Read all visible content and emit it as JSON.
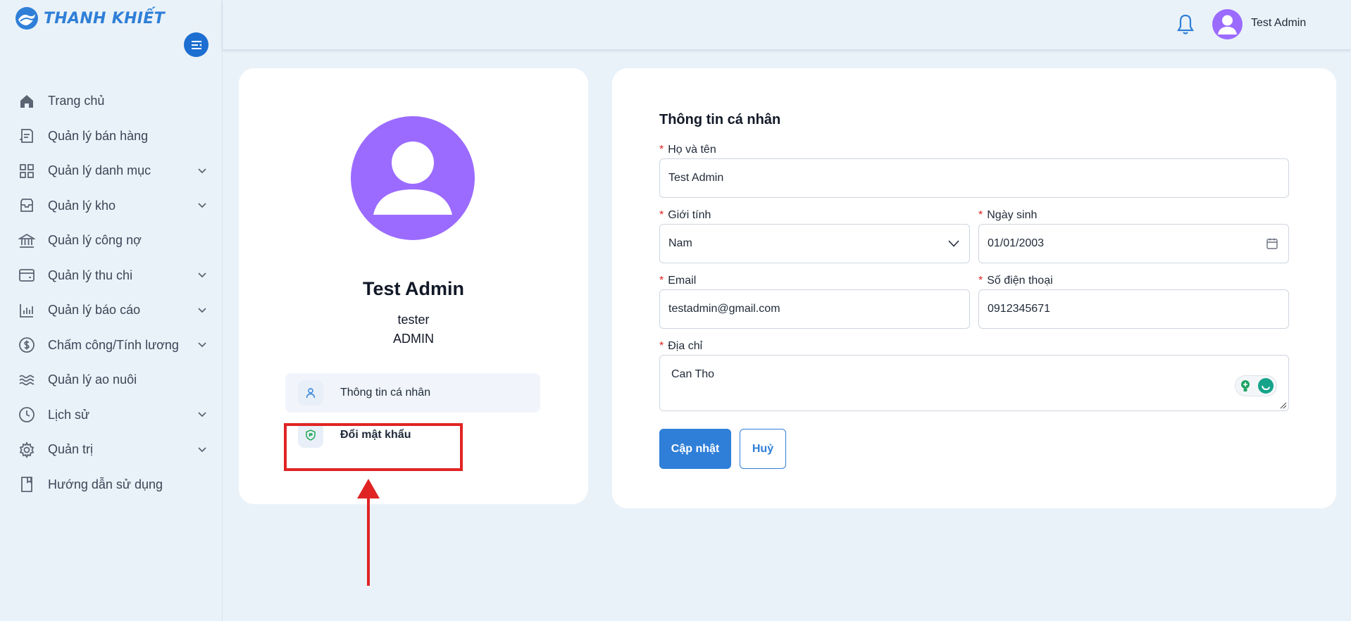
{
  "brand": {
    "name": "THANH KHIẾT",
    "accent": "#2f7fd8"
  },
  "sidebar": {
    "items": [
      {
        "label": "Trang chủ",
        "icon": "home-icon",
        "expandable": false
      },
      {
        "label": "Quản lý bán hàng",
        "icon": "sales-icon",
        "expandable": false
      },
      {
        "label": "Quản lý danh mục",
        "icon": "grid-icon",
        "expandable": true
      },
      {
        "label": "Quản lý kho",
        "icon": "inbox-icon",
        "expandable": true
      },
      {
        "label": "Quản lý công nợ",
        "icon": "bank-icon",
        "expandable": false
      },
      {
        "label": "Quản lý thu chi",
        "icon": "wallet-icon",
        "expandable": true
      },
      {
        "label": "Quản lý báo cáo",
        "icon": "bar-chart-icon",
        "expandable": true
      },
      {
        "label": "Chấm công/Tính lương",
        "icon": "dollar-icon",
        "expandable": true
      },
      {
        "label": "Quản lý ao nuôi",
        "icon": "waves-icon",
        "expandable": false
      },
      {
        "label": "Lịch sử",
        "icon": "clock-icon",
        "expandable": true
      },
      {
        "label": "Quản trị",
        "icon": "gear-icon",
        "expandable": true
      },
      {
        "label": "Hướng dẫn sử dụng",
        "icon": "book-icon",
        "expandable": false
      }
    ]
  },
  "header": {
    "user_name": "Test Admin"
  },
  "profile": {
    "name": "Test Admin",
    "username": "tester",
    "role": "ADMIN",
    "menu": {
      "info_label": "Thông tin cá nhân",
      "password_label": "Đổi mật khẩu"
    }
  },
  "form": {
    "title": "Thông tin cá nhân",
    "required_mark": "*",
    "fullname": {
      "label": "Họ và tên",
      "value": "Test Admin"
    },
    "gender": {
      "label": "Giới tính",
      "value": "Nam"
    },
    "birthday": {
      "label": "Ngày sinh",
      "value": "01/01/2003"
    },
    "email": {
      "label": "Email",
      "value": "testadmin@gmail.com"
    },
    "phone": {
      "label": "Số điện thoại",
      "value": "0912345671"
    },
    "address": {
      "label": "Địa chỉ",
      "value": "Can Tho"
    },
    "update_label": "Cập nhật",
    "cancel_label": "Huỷ"
  },
  "colors": {
    "avatar": "#9b6bff",
    "annotation": "#e02424",
    "primary": "#2f7fd8"
  }
}
